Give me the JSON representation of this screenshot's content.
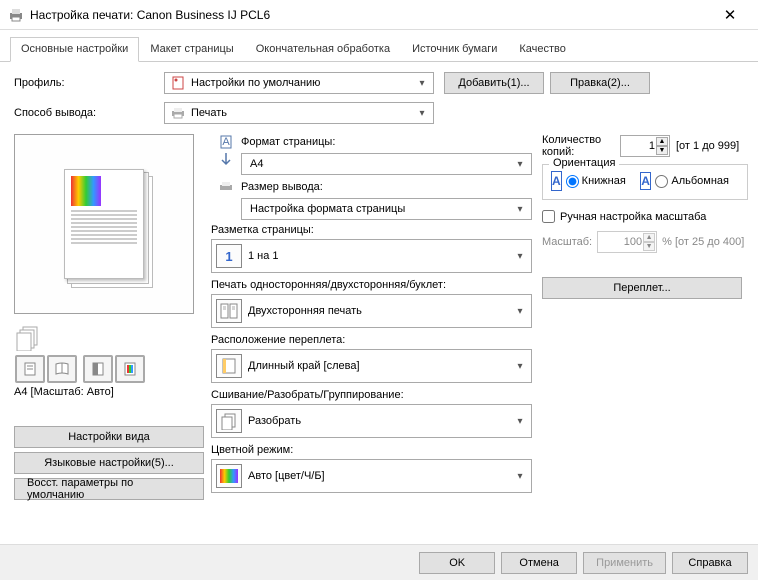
{
  "window": {
    "title": "Настройка печати: Canon Business IJ PCL6"
  },
  "tabs": [
    "Основные настройки",
    "Макет страницы",
    "Окончательная обработка",
    "Источник бумаги",
    "Качество"
  ],
  "top": {
    "profile_lbl": "Профиль:",
    "profile_val": "Настройки по умолчанию",
    "add_btn": "Добавить(1)...",
    "edit_btn": "Правка(2)...",
    "output_lbl": "Способ вывода:",
    "output_val": "Печать"
  },
  "preview": {
    "caption": "A4 [Масштаб: Авто]",
    "side": {
      "view_btn": "Настройки вида",
      "lang_btn": "Языковые настройки(5)...",
      "reset_btn": "Восст. параметры по умолчанию"
    }
  },
  "mid": {
    "page_size_lbl": "Формат страницы:",
    "page_size_val": "A4",
    "out_size_lbl": "Размер вывода:",
    "out_size_val": "Настройка формата страницы",
    "layout_lbl": "Разметка страницы:",
    "layout_val": "1 на 1",
    "layout_icon": "1",
    "duplex_lbl": "Печать односторонняя/двухсторонняя/буклет:",
    "duplex_val": "Двухсторонняя печать",
    "bind_lbl": "Расположение переплета:",
    "bind_val": "Длинный край [слева]",
    "stitch_lbl": "Сшивание/Разобрать/Группирование:",
    "stitch_val": "Разобрать",
    "color_lbl": "Цветной режим:",
    "color_val": "Авто [цвет/Ч/Б]"
  },
  "right": {
    "copies_lbl": "Количество копий:",
    "copies_val": "1",
    "copies_range": "[от 1 до 999]",
    "orient_legend": "Ориентация",
    "orient_portrait": "Книжная",
    "orient_landscape": "Альбомная",
    "manual_chk": "Ручная настройка масштаба",
    "scale_lbl": "Масштаб:",
    "scale_val": "100",
    "scale_range": "% [от 25 до 400]",
    "bind_btn": "Переплет..."
  },
  "footer": {
    "ok": "OK",
    "cancel": "Отмена",
    "apply": "Применить",
    "help": "Справка"
  }
}
